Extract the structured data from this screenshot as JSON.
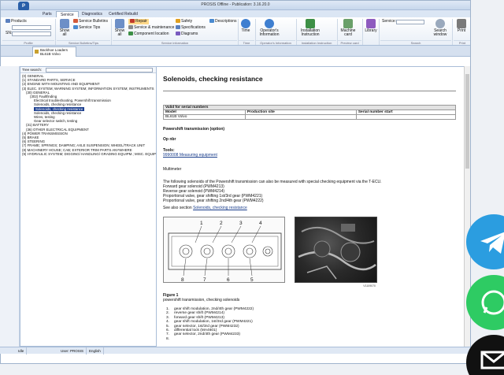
{
  "window": {
    "title": "PROSIS Offline - Publication: 3.16.20.0",
    "logo": "P"
  },
  "ribbon_tabs": [
    "Parts",
    "Service",
    "Diagnostics",
    "Certified Rebuild"
  ],
  "ribbon": {
    "products": "Products",
    "sn_label": "SN:",
    "show_all_1": "Show all",
    "service_bulletins": "Service Bulletins",
    "service_tips": "Service Tips",
    "show_all_2": "Show all",
    "repair": "Repair",
    "service_maintenance": "Service & maintenance",
    "component_location": "Component location",
    "safety": "Safety",
    "specifications": "Specifications",
    "diagrams": "Diagrams",
    "descriptions": "Descriptions",
    "time": "Time",
    "operators_info": "Operator's Information",
    "installation_instruction": "Installation Instruction",
    "machine_card": "Machine card",
    "library": "Library",
    "service_label": "Service:",
    "search_window": "Search window",
    "print": "Print",
    "groups": {
      "profile": "Profile",
      "bulletins_tips": "Service Bulletins/Tips",
      "service_info": "Service information",
      "time": "Time",
      "operators": "Operator's Information",
      "installation": "Installation Instruction",
      "preview": "Preview card",
      "search": "Search",
      "print": "Print"
    }
  },
  "doc_tab": {
    "line1": "Backhoe Loaders",
    "line2": "BL61B Volvo"
  },
  "tree_search_label": "Tree search:",
  "tree": [
    {
      "text": "(0) GENERAL",
      "indent": 0
    },
    {
      "text": "(1) STANDARD PARTS, SERVICE",
      "indent": 0
    },
    {
      "text": "(2) ENGINE WITH MOUNTING AND EQUIPMENT",
      "indent": 0
    },
    {
      "text": "(3) ELEC. SYSTEM; WARNING SYSTEM; INFORMATION SYSTEM; INSTRUMENTS",
      "indent": 0
    },
    {
      "text": "(30) GENERAL",
      "indent": 1
    },
    {
      "text": "(302) Faultfinding",
      "indent": 2
    },
    {
      "text": "Electrical troubleshooting, Powershift transmission",
      "indent": 3,
      "leaf": true
    },
    {
      "text": "Solenoids, checking resistance",
      "indent": 3,
      "leaf": true
    },
    {
      "text": "Solenoids, checking resistance",
      "indent": 3,
      "leaf": true,
      "selected": true
    },
    {
      "text": "Solenoids, checking resistance",
      "indent": 3,
      "leaf": true
    },
    {
      "text": "Wires, testing",
      "indent": 3,
      "leaf": true
    },
    {
      "text": "Gear selector switch, testing",
      "indent": 3,
      "leaf": true
    },
    {
      "text": "(31) BATTERY",
      "indent": 1
    },
    {
      "text": "(36) OTHER ELECTRICAL EQUIPMENT",
      "indent": 1
    },
    {
      "text": "(4) POWER TRANSMISSION",
      "indent": 0
    },
    {
      "text": "(5) BRAKE",
      "indent": 0
    },
    {
      "text": "(6) STEERING",
      "indent": 0
    },
    {
      "text": "(7) FRAME; SPRINGS; DAMPING; AXLE SUSPENSION;  WHEEL/TRACK UNIT",
      "indent": 0
    },
    {
      "text": "(8) MACHINERY HOUSE; CAB; EXTERIOR TRIM PARTS  ANYWHERE",
      "indent": 0
    },
    {
      "text": "(9) HYDRAULIC SYSTEM; DIGGING/ HANDLING/  GRADING EQUIPM.; MISC. EQUIPMENT",
      "indent": 0
    }
  ],
  "doc": {
    "title": "Solenoids, checking resistance",
    "serial_table": {
      "header": "Valid for serial numbers",
      "columns": [
        "Model",
        "Production site",
        "Serial number start"
      ],
      "rows": [
        [
          "BL61B Volvo",
          "",
          ""
        ]
      ]
    },
    "section": "Powershift transmission (option)",
    "op_nbr": "Op nbr",
    "tools_label": "Tools:",
    "tool_link": "9990008 Measuring equipment",
    "multimeter": "Multimeter",
    "intro": "The following solenoids of the Powershift transmission can also be measured with special checking equipment via the T-ECU.",
    "solenoids": [
      "Forward gear solenoid (PWM4213)",
      "Reverse gear solenoid (PWM4214)",
      "Proportional valve, gear shifting 1st/3rd gear (PWM4221)",
      "Proportional valve, gear shifting 2nd/4th gear (PWM4222)"
    ],
    "see_also_prefix": "See also section ",
    "see_also_link": "Solenoids, checking resistance",
    "diagram_numbers_top": [
      "1",
      "2",
      "3",
      "4"
    ],
    "diagram_numbers_bottom": [
      "8",
      "7",
      "6",
      "5"
    ],
    "photo_code": "V1109070",
    "figure_label": "Figure 1",
    "figure_caption": "powershift transmission, checking solenoids",
    "figure_list": [
      {
        "n": "1.",
        "text": "gear shift modulation, 2nd/4th gear (PWM4222)"
      },
      {
        "n": "2.",
        "text": "reverse gear shift (PWM4214)"
      },
      {
        "n": "3.",
        "text": "forward gear shift (PWM4213)"
      },
      {
        "n": "4.",
        "text": "gear shift modulation, 1st/3rd gear (PWM4221)"
      },
      {
        "n": "5.",
        "text": "gear selector, 1st/3rd gear (PWM4232)"
      },
      {
        "n": "6.",
        "text": "differential lock (MA4601)"
      },
      {
        "n": "7.",
        "text": "gear selector, 2nd/4th gear (PWM4233)"
      },
      {
        "n": "8.",
        "text": ""
      }
    ]
  },
  "status": {
    "left": "Idle",
    "user": "User: PROSIS",
    "lang": "English"
  },
  "colors": {
    "accent": "#1c3f8f",
    "telegram": "#2b9de0",
    "whatsapp": "#2ecb63",
    "mail": "#111111"
  }
}
